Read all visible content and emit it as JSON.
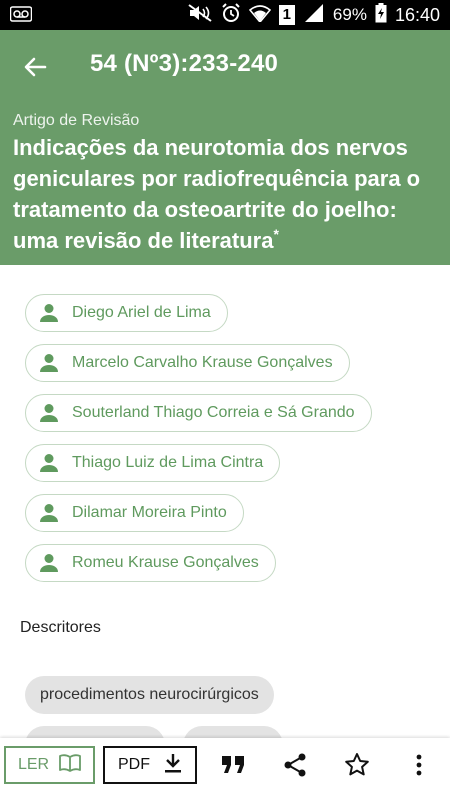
{
  "status_bar": {
    "battery_percent": "69%",
    "time": "16:40",
    "sim_badge": "1",
    "icons": [
      "voicemail-icon",
      "mute-icon",
      "alarm-icon",
      "wifi-icon",
      "signal-icon",
      "battery-charging-icon"
    ]
  },
  "app_bar": {
    "title": "54 (Nº3):233-240",
    "back_icon": "arrow-back-icon"
  },
  "article": {
    "section": "Artigo de Revisão",
    "title": "Indicações da neurotomia dos nervos geniculares por radiofrequência para o tratamento da osteoartrite do joelho: uma revisão de literatura",
    "title_mark": "*"
  },
  "authors": [
    "Diego Ariel de Lima",
    "Marcelo Carvalho Krause Gonçalves",
    "Souterland Thiago Correia e Sá Grando",
    "Thiago Luiz de Lima Cintra",
    "Dilamar Moreira Pinto",
    "Romeu Krause Gonçalves"
  ],
  "descriptors": {
    "heading": "Descritores",
    "tags": [
      "procedimentos neurocirúrgicos"
    ]
  },
  "toolbar": {
    "read_label": "LER",
    "pdf_label": "PDF",
    "icons": [
      "book-icon",
      "download-icon",
      "quote-icon",
      "share-icon",
      "star-outline-icon",
      "more-vert-icon"
    ]
  },
  "colors": {
    "primary": "#6a9c69",
    "chip_text": "#5f9a5e",
    "chip_border": "#c5d9c4",
    "tag_bg": "#e3e3e3"
  }
}
